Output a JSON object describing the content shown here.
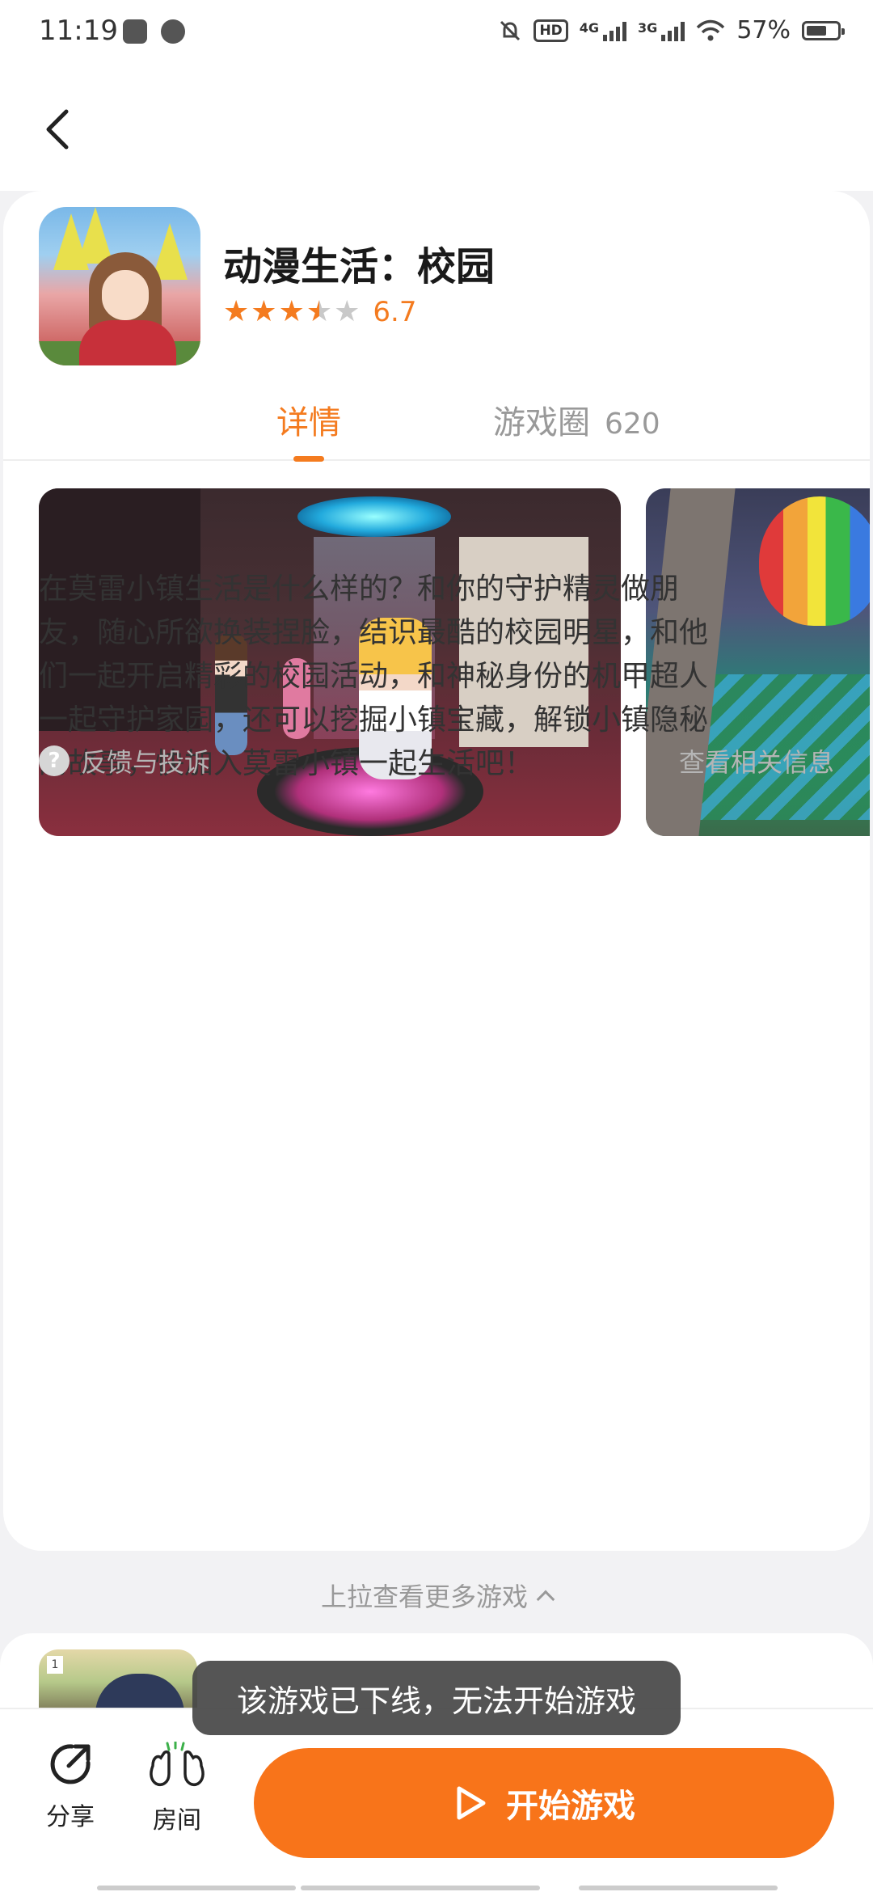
{
  "status_bar": {
    "time": "11:19",
    "network1": "4G",
    "network2": "3G",
    "battery": "57%"
  },
  "app": {
    "title": "动漫生活：校园",
    "rating": "6.7",
    "rating_stars": 3.5,
    "accent_color": "#f47b1f"
  },
  "tabs": {
    "details": "详情",
    "circle": "游戏圈",
    "circle_count": "620"
  },
  "description": [
    "在莫雷小镇生活是什么样的？和你的守护精灵做朋",
    "友，随心所欲换装捏脸，结识最酷的校园明星，和他",
    "们一起开启精彩的校园活动，和神秘身份的机甲超人",
    "一起守护家园，还可以挖掘小镇宝藏，解锁小镇隐秘",
    "的故事，快加入莫雷小镇一起生活吧！"
  ],
  "feedback": {
    "icon": "?",
    "label": "反馈与投诉",
    "related": "查看相关信息"
  },
  "pull_up": "上拉查看更多游戏",
  "next_card": {
    "badge": "1"
  },
  "bottom_bar": {
    "share": "分享",
    "room": "房间",
    "start": "开始游戏"
  },
  "toast": "该游戏已下线，无法开始游戏"
}
